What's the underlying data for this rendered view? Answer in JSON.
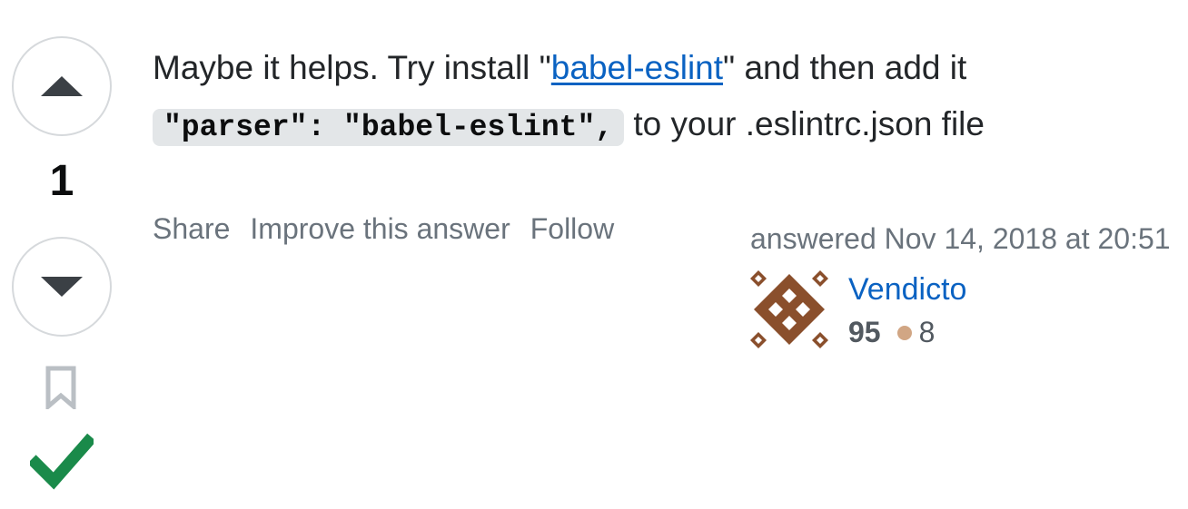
{
  "vote": {
    "count": "1"
  },
  "post": {
    "text_before_link": "Maybe it helps. Try install \"",
    "link_text": "babel-eslint",
    "text_after_link": "\" and then add it",
    "code": "\"parser\": \"babel-eslint\",",
    "text_after_code": " to your .eslintrc.json file"
  },
  "menu": {
    "share": "Share",
    "improve": "Improve this answer",
    "follow": "Follow"
  },
  "signature": {
    "answered": "answered Nov 14, 2018 at 20:51",
    "user_name": "Vendicto",
    "reputation": "95",
    "bronze_badges": "8"
  },
  "colors": {
    "link": "#0a62c2",
    "accepted": "#1a8a4a",
    "avatar": "#8a4f2c",
    "bronze": "#d1a684"
  },
  "icons": {
    "vote_up": "triangle-up-icon",
    "vote_down": "triangle-down-icon",
    "bookmark": "bookmark-icon",
    "accepted": "checkmark-icon"
  }
}
